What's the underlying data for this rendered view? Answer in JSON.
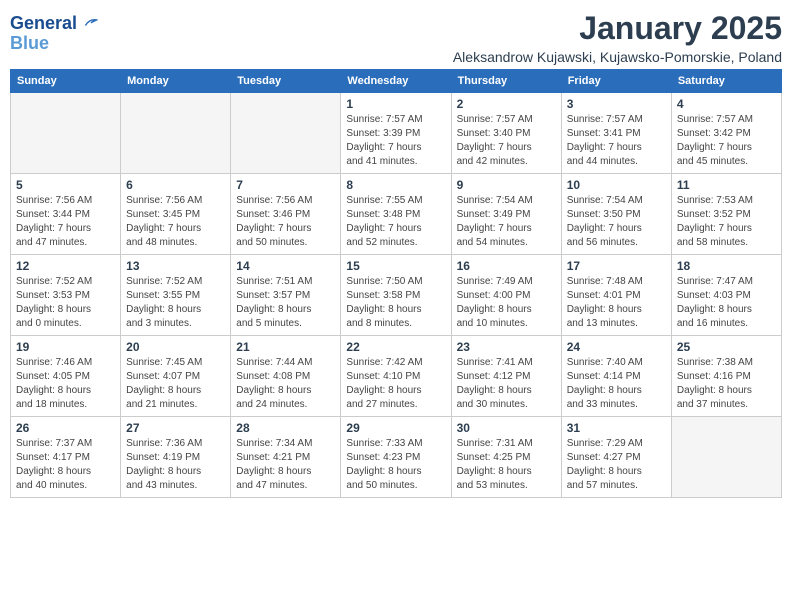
{
  "header": {
    "logo_line1": "General",
    "logo_line2": "Blue",
    "month_title": "January 2025",
    "subtitle": "Aleksandrow Kujawski, Kujawsko-Pomorskie, Poland"
  },
  "weekdays": [
    "Sunday",
    "Monday",
    "Tuesday",
    "Wednesday",
    "Thursday",
    "Friday",
    "Saturday"
  ],
  "weeks": [
    [
      {
        "day": "",
        "info": ""
      },
      {
        "day": "",
        "info": ""
      },
      {
        "day": "",
        "info": ""
      },
      {
        "day": "1",
        "info": "Sunrise: 7:57 AM\nSunset: 3:39 PM\nDaylight: 7 hours\nand 41 minutes."
      },
      {
        "day": "2",
        "info": "Sunrise: 7:57 AM\nSunset: 3:40 PM\nDaylight: 7 hours\nand 42 minutes."
      },
      {
        "day": "3",
        "info": "Sunrise: 7:57 AM\nSunset: 3:41 PM\nDaylight: 7 hours\nand 44 minutes."
      },
      {
        "day": "4",
        "info": "Sunrise: 7:57 AM\nSunset: 3:42 PM\nDaylight: 7 hours\nand 45 minutes."
      }
    ],
    [
      {
        "day": "5",
        "info": "Sunrise: 7:56 AM\nSunset: 3:44 PM\nDaylight: 7 hours\nand 47 minutes."
      },
      {
        "day": "6",
        "info": "Sunrise: 7:56 AM\nSunset: 3:45 PM\nDaylight: 7 hours\nand 48 minutes."
      },
      {
        "day": "7",
        "info": "Sunrise: 7:56 AM\nSunset: 3:46 PM\nDaylight: 7 hours\nand 50 minutes."
      },
      {
        "day": "8",
        "info": "Sunrise: 7:55 AM\nSunset: 3:48 PM\nDaylight: 7 hours\nand 52 minutes."
      },
      {
        "day": "9",
        "info": "Sunrise: 7:54 AM\nSunset: 3:49 PM\nDaylight: 7 hours\nand 54 minutes."
      },
      {
        "day": "10",
        "info": "Sunrise: 7:54 AM\nSunset: 3:50 PM\nDaylight: 7 hours\nand 56 minutes."
      },
      {
        "day": "11",
        "info": "Sunrise: 7:53 AM\nSunset: 3:52 PM\nDaylight: 7 hours\nand 58 minutes."
      }
    ],
    [
      {
        "day": "12",
        "info": "Sunrise: 7:52 AM\nSunset: 3:53 PM\nDaylight: 8 hours\nand 0 minutes."
      },
      {
        "day": "13",
        "info": "Sunrise: 7:52 AM\nSunset: 3:55 PM\nDaylight: 8 hours\nand 3 minutes."
      },
      {
        "day": "14",
        "info": "Sunrise: 7:51 AM\nSunset: 3:57 PM\nDaylight: 8 hours\nand 5 minutes."
      },
      {
        "day": "15",
        "info": "Sunrise: 7:50 AM\nSunset: 3:58 PM\nDaylight: 8 hours\nand 8 minutes."
      },
      {
        "day": "16",
        "info": "Sunrise: 7:49 AM\nSunset: 4:00 PM\nDaylight: 8 hours\nand 10 minutes."
      },
      {
        "day": "17",
        "info": "Sunrise: 7:48 AM\nSunset: 4:01 PM\nDaylight: 8 hours\nand 13 minutes."
      },
      {
        "day": "18",
        "info": "Sunrise: 7:47 AM\nSunset: 4:03 PM\nDaylight: 8 hours\nand 16 minutes."
      }
    ],
    [
      {
        "day": "19",
        "info": "Sunrise: 7:46 AM\nSunset: 4:05 PM\nDaylight: 8 hours\nand 18 minutes."
      },
      {
        "day": "20",
        "info": "Sunrise: 7:45 AM\nSunset: 4:07 PM\nDaylight: 8 hours\nand 21 minutes."
      },
      {
        "day": "21",
        "info": "Sunrise: 7:44 AM\nSunset: 4:08 PM\nDaylight: 8 hours\nand 24 minutes."
      },
      {
        "day": "22",
        "info": "Sunrise: 7:42 AM\nSunset: 4:10 PM\nDaylight: 8 hours\nand 27 minutes."
      },
      {
        "day": "23",
        "info": "Sunrise: 7:41 AM\nSunset: 4:12 PM\nDaylight: 8 hours\nand 30 minutes."
      },
      {
        "day": "24",
        "info": "Sunrise: 7:40 AM\nSunset: 4:14 PM\nDaylight: 8 hours\nand 33 minutes."
      },
      {
        "day": "25",
        "info": "Sunrise: 7:38 AM\nSunset: 4:16 PM\nDaylight: 8 hours\nand 37 minutes."
      }
    ],
    [
      {
        "day": "26",
        "info": "Sunrise: 7:37 AM\nSunset: 4:17 PM\nDaylight: 8 hours\nand 40 minutes."
      },
      {
        "day": "27",
        "info": "Sunrise: 7:36 AM\nSunset: 4:19 PM\nDaylight: 8 hours\nand 43 minutes."
      },
      {
        "day": "28",
        "info": "Sunrise: 7:34 AM\nSunset: 4:21 PM\nDaylight: 8 hours\nand 47 minutes."
      },
      {
        "day": "29",
        "info": "Sunrise: 7:33 AM\nSunset: 4:23 PM\nDaylight: 8 hours\nand 50 minutes."
      },
      {
        "day": "30",
        "info": "Sunrise: 7:31 AM\nSunset: 4:25 PM\nDaylight: 8 hours\nand 53 minutes."
      },
      {
        "day": "31",
        "info": "Sunrise: 7:29 AM\nSunset: 4:27 PM\nDaylight: 8 hours\nand 57 minutes."
      },
      {
        "day": "",
        "info": ""
      }
    ]
  ]
}
